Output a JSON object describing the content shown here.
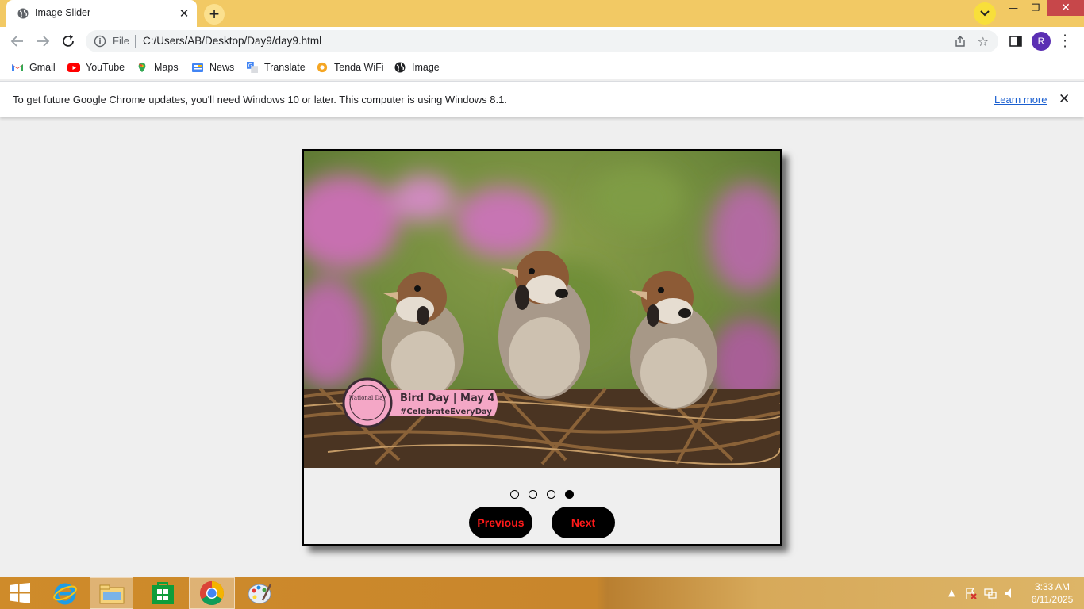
{
  "browser": {
    "tab_title": "Image Slider",
    "omnibox": {
      "scheme_label": "File",
      "url": "C:/Users/AB/Desktop/Day9/day9.html"
    },
    "profile_initial": "R",
    "theme_color": "#f2c964"
  },
  "bookmarks": [
    {
      "label": "Gmail",
      "icon": "gmail-icon"
    },
    {
      "label": "YouTube",
      "icon": "youtube-icon"
    },
    {
      "label": "Maps",
      "icon": "maps-icon"
    },
    {
      "label": "News",
      "icon": "news-icon"
    },
    {
      "label": "Translate",
      "icon": "translate-icon"
    },
    {
      "label": "Tenda WiFi",
      "icon": "tenda-icon"
    },
    {
      "label": "Image",
      "icon": "globe-icon"
    }
  ],
  "infobar": {
    "message": "To get future Google Chrome updates, you'll need Windows 10 or later. This computer is using Windows 8.1.",
    "link": "Learn more"
  },
  "slider": {
    "image_caption": {
      "title": "Bird Day | May 4",
      "hashtag": "#CelebrateEveryDay",
      "badge": "National Day"
    },
    "dots_total": 4,
    "active_dot": 4,
    "prev_label": "Previous",
    "next_label": "Next",
    "button_text_color": "#ff1a1a"
  },
  "taskbar": {
    "apps": [
      "start-icon",
      "internet-explorer-icon",
      "file-explorer-icon",
      "store-icon",
      "chrome-icon",
      "paint-icon"
    ],
    "time": "3:33 AM",
    "date": "6/11/2025"
  }
}
